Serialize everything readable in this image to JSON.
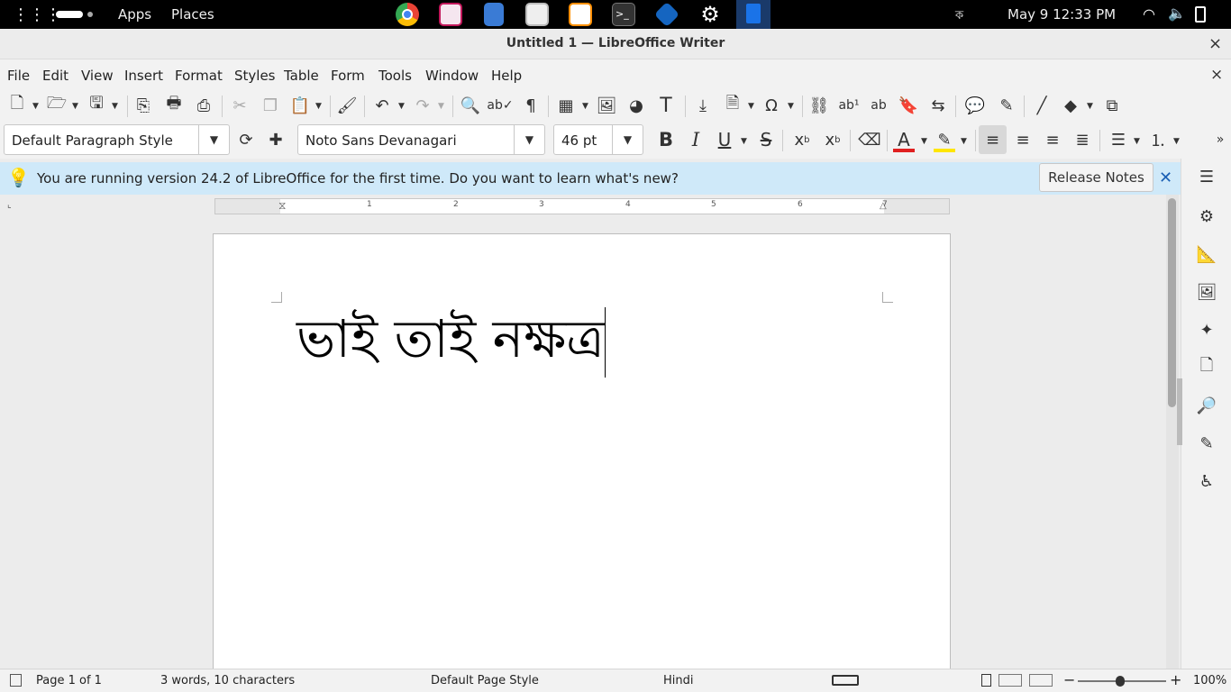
{
  "topbar": {
    "apps_label": "Apps",
    "places_label": "Places",
    "keyboard_layout": "ক",
    "clock": "May 9  12:33 PM",
    "dock": [
      {
        "name": "chrome",
        "color": "#4285f4"
      },
      {
        "name": "calendar",
        "color": "#c2185b"
      },
      {
        "name": "documents",
        "color": "#3a7bd5"
      },
      {
        "name": "store",
        "color": "#e0e0e0"
      },
      {
        "name": "editor",
        "color": "#ff8f00"
      },
      {
        "name": "terminal",
        "color": "#333333"
      },
      {
        "name": "vscode-like",
        "color": "#1565c0"
      },
      {
        "name": "settings",
        "color": "#dddddd"
      },
      {
        "name": "writer",
        "color": "#1a73e8"
      }
    ]
  },
  "window": {
    "title": "Untitled 1 — LibreOffice Writer",
    "close": "×"
  },
  "menu": [
    "File",
    "Edit",
    "View",
    "Insert",
    "Format",
    "Styles",
    "Table",
    "Form",
    "Tools",
    "Window",
    "Help"
  ],
  "menu_close": "×",
  "formatting": {
    "paragraph_style": "Default Paragraph Style",
    "font_name": "Noto Sans Devanagari",
    "font_size": "46 pt"
  },
  "infobar": {
    "message": "You are running version 24.2 of LibreOffice for the first time. Do you want to learn what's new?",
    "button": "Release Notes",
    "close": "✕"
  },
  "document": {
    "text": "ভাই তাই নক্ষত্র"
  },
  "ruler_numbers": [
    "1",
    "2",
    "3",
    "4",
    "5",
    "6",
    "7"
  ],
  "status": {
    "page": "Page 1 of 1",
    "words": "3 words, 10 characters",
    "page_style": "Default Page Style",
    "language": "Hindi",
    "zoom": "100%"
  },
  "colors": {
    "font_color": "#e02020",
    "highlight_color": "#ffe600",
    "infobar_bg": "#cfe9f9"
  }
}
